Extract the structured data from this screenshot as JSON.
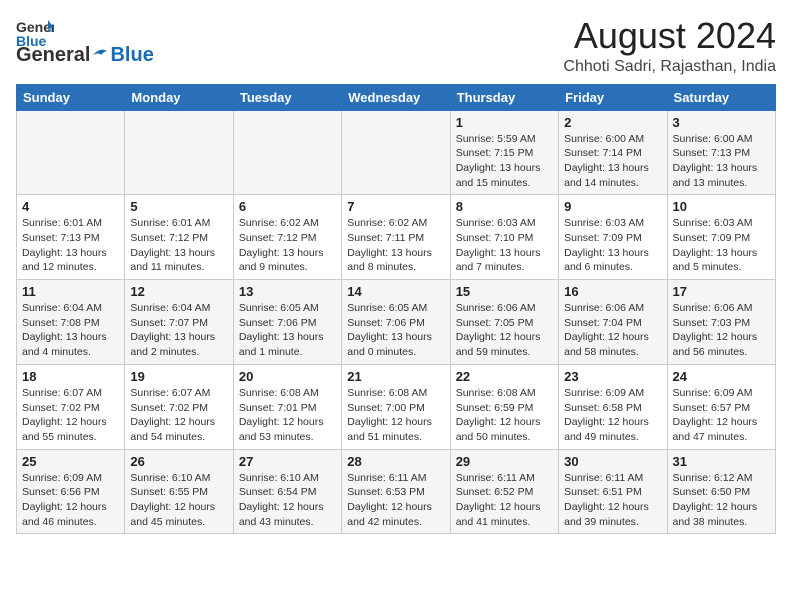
{
  "logo": {
    "line1": "General",
    "line2": "Blue"
  },
  "title": "August 2024",
  "subtitle": "Chhoti Sadri, Rajasthan, India",
  "days_of_week": [
    "Sunday",
    "Monday",
    "Tuesday",
    "Wednesday",
    "Thursday",
    "Friday",
    "Saturday"
  ],
  "weeks": [
    [
      {
        "day": "",
        "detail": ""
      },
      {
        "day": "",
        "detail": ""
      },
      {
        "day": "",
        "detail": ""
      },
      {
        "day": "",
        "detail": ""
      },
      {
        "day": "1",
        "detail": "Sunrise: 5:59 AM\nSunset: 7:15 PM\nDaylight: 13 hours\nand 15 minutes."
      },
      {
        "day": "2",
        "detail": "Sunrise: 6:00 AM\nSunset: 7:14 PM\nDaylight: 13 hours\nand 14 minutes."
      },
      {
        "day": "3",
        "detail": "Sunrise: 6:00 AM\nSunset: 7:13 PM\nDaylight: 13 hours\nand 13 minutes."
      }
    ],
    [
      {
        "day": "4",
        "detail": "Sunrise: 6:01 AM\nSunset: 7:13 PM\nDaylight: 13 hours\nand 12 minutes."
      },
      {
        "day": "5",
        "detail": "Sunrise: 6:01 AM\nSunset: 7:12 PM\nDaylight: 13 hours\nand 11 minutes."
      },
      {
        "day": "6",
        "detail": "Sunrise: 6:02 AM\nSunset: 7:12 PM\nDaylight: 13 hours\nand 9 minutes."
      },
      {
        "day": "7",
        "detail": "Sunrise: 6:02 AM\nSunset: 7:11 PM\nDaylight: 13 hours\nand 8 minutes."
      },
      {
        "day": "8",
        "detail": "Sunrise: 6:03 AM\nSunset: 7:10 PM\nDaylight: 13 hours\nand 7 minutes."
      },
      {
        "day": "9",
        "detail": "Sunrise: 6:03 AM\nSunset: 7:09 PM\nDaylight: 13 hours\nand 6 minutes."
      },
      {
        "day": "10",
        "detail": "Sunrise: 6:03 AM\nSunset: 7:09 PM\nDaylight: 13 hours\nand 5 minutes."
      }
    ],
    [
      {
        "day": "11",
        "detail": "Sunrise: 6:04 AM\nSunset: 7:08 PM\nDaylight: 13 hours\nand 4 minutes."
      },
      {
        "day": "12",
        "detail": "Sunrise: 6:04 AM\nSunset: 7:07 PM\nDaylight: 13 hours\nand 2 minutes."
      },
      {
        "day": "13",
        "detail": "Sunrise: 6:05 AM\nSunset: 7:06 PM\nDaylight: 13 hours\nand 1 minute."
      },
      {
        "day": "14",
        "detail": "Sunrise: 6:05 AM\nSunset: 7:06 PM\nDaylight: 13 hours\nand 0 minutes."
      },
      {
        "day": "15",
        "detail": "Sunrise: 6:06 AM\nSunset: 7:05 PM\nDaylight: 12 hours\nand 59 minutes."
      },
      {
        "day": "16",
        "detail": "Sunrise: 6:06 AM\nSunset: 7:04 PM\nDaylight: 12 hours\nand 58 minutes."
      },
      {
        "day": "17",
        "detail": "Sunrise: 6:06 AM\nSunset: 7:03 PM\nDaylight: 12 hours\nand 56 minutes."
      }
    ],
    [
      {
        "day": "18",
        "detail": "Sunrise: 6:07 AM\nSunset: 7:02 PM\nDaylight: 12 hours\nand 55 minutes."
      },
      {
        "day": "19",
        "detail": "Sunrise: 6:07 AM\nSunset: 7:02 PM\nDaylight: 12 hours\nand 54 minutes."
      },
      {
        "day": "20",
        "detail": "Sunrise: 6:08 AM\nSunset: 7:01 PM\nDaylight: 12 hours\nand 53 minutes."
      },
      {
        "day": "21",
        "detail": "Sunrise: 6:08 AM\nSunset: 7:00 PM\nDaylight: 12 hours\nand 51 minutes."
      },
      {
        "day": "22",
        "detail": "Sunrise: 6:08 AM\nSunset: 6:59 PM\nDaylight: 12 hours\nand 50 minutes."
      },
      {
        "day": "23",
        "detail": "Sunrise: 6:09 AM\nSunset: 6:58 PM\nDaylight: 12 hours\nand 49 minutes."
      },
      {
        "day": "24",
        "detail": "Sunrise: 6:09 AM\nSunset: 6:57 PM\nDaylight: 12 hours\nand 47 minutes."
      }
    ],
    [
      {
        "day": "25",
        "detail": "Sunrise: 6:09 AM\nSunset: 6:56 PM\nDaylight: 12 hours\nand 46 minutes."
      },
      {
        "day": "26",
        "detail": "Sunrise: 6:10 AM\nSunset: 6:55 PM\nDaylight: 12 hours\nand 45 minutes."
      },
      {
        "day": "27",
        "detail": "Sunrise: 6:10 AM\nSunset: 6:54 PM\nDaylight: 12 hours\nand 43 minutes."
      },
      {
        "day": "28",
        "detail": "Sunrise: 6:11 AM\nSunset: 6:53 PM\nDaylight: 12 hours\nand 42 minutes."
      },
      {
        "day": "29",
        "detail": "Sunrise: 6:11 AM\nSunset: 6:52 PM\nDaylight: 12 hours\nand 41 minutes."
      },
      {
        "day": "30",
        "detail": "Sunrise: 6:11 AM\nSunset: 6:51 PM\nDaylight: 12 hours\nand 39 minutes."
      },
      {
        "day": "31",
        "detail": "Sunrise: 6:12 AM\nSunset: 6:50 PM\nDaylight: 12 hours\nand 38 minutes."
      }
    ]
  ]
}
